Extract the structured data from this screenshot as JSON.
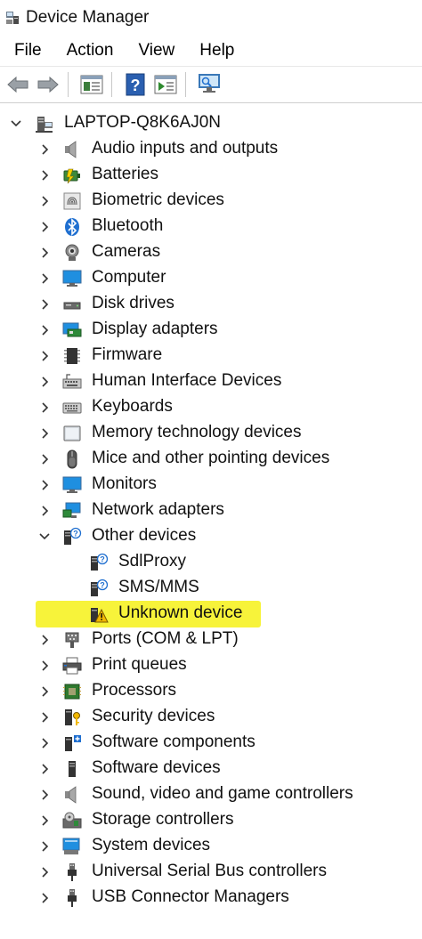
{
  "window": {
    "title": "Device Manager"
  },
  "menu": [
    "File",
    "Action",
    "View",
    "Help"
  ],
  "toolbar": {
    "buttons": [
      "back-icon",
      "forward-icon",
      "properties-icon",
      "help-icon",
      "update-driver-icon",
      "scan-hardware-icon"
    ]
  },
  "tree": {
    "root": "LAPTOP-Q8K6AJ0N",
    "categories": [
      {
        "label": "Audio inputs and outputs",
        "icon": "speaker-icon",
        "expanded": false
      },
      {
        "label": "Batteries",
        "icon": "battery-icon",
        "expanded": false
      },
      {
        "label": "Biometric devices",
        "icon": "fingerprint-icon",
        "expanded": false
      },
      {
        "label": "Bluetooth",
        "icon": "bluetooth-icon",
        "expanded": false
      },
      {
        "label": "Cameras",
        "icon": "camera-icon",
        "expanded": false
      },
      {
        "label": "Computer",
        "icon": "computer-icon",
        "expanded": false
      },
      {
        "label": "Disk drives",
        "icon": "disk-drive-icon",
        "expanded": false
      },
      {
        "label": "Display adapters",
        "icon": "display-adapter-icon",
        "expanded": false
      },
      {
        "label": "Firmware",
        "icon": "firmware-icon",
        "expanded": false
      },
      {
        "label": "Human Interface Devices",
        "icon": "hid-icon",
        "expanded": false
      },
      {
        "label": "Keyboards",
        "icon": "keyboard-icon",
        "expanded": false
      },
      {
        "label": "Memory technology devices",
        "icon": "memory-icon",
        "expanded": false
      },
      {
        "label": "Mice and other pointing devices",
        "icon": "mouse-icon",
        "expanded": false
      },
      {
        "label": "Monitors",
        "icon": "monitor-icon",
        "expanded": false
      },
      {
        "label": "Network adapters",
        "icon": "network-adapter-icon",
        "expanded": false
      },
      {
        "label": "Other devices",
        "icon": "unknown-device-icon",
        "expanded": true,
        "children": [
          {
            "label": "SdlProxy",
            "icon": "unknown-device-icon",
            "warning": false
          },
          {
            "label": "SMS/MMS",
            "icon": "unknown-device-icon",
            "warning": false
          },
          {
            "label": "Unknown device",
            "icon": "warning-device-icon",
            "warning": true,
            "highlighted": true
          }
        ]
      },
      {
        "label": "Ports (COM & LPT)",
        "icon": "port-icon",
        "expanded": false
      },
      {
        "label": "Print queues",
        "icon": "printer-icon",
        "expanded": false
      },
      {
        "label": "Processors",
        "icon": "processor-icon",
        "expanded": false
      },
      {
        "label": "Security devices",
        "icon": "security-device-icon",
        "expanded": false
      },
      {
        "label": "Software components",
        "icon": "software-component-icon",
        "expanded": false
      },
      {
        "label": "Software devices",
        "icon": "software-device-icon",
        "expanded": false
      },
      {
        "label": "Sound, video and game controllers",
        "icon": "speaker-icon",
        "expanded": false
      },
      {
        "label": "Storage controllers",
        "icon": "storage-controller-icon",
        "expanded": false
      },
      {
        "label": "System devices",
        "icon": "system-device-icon",
        "expanded": false
      },
      {
        "label": "Universal Serial Bus controllers",
        "icon": "usb-icon",
        "expanded": false
      },
      {
        "label": "USB Connector Managers",
        "icon": "usb-icon",
        "expanded": false
      }
    ]
  },
  "colors": {
    "highlight": "#f7f33a",
    "accent": "#1f6fd0",
    "warning": "#f2b800"
  }
}
